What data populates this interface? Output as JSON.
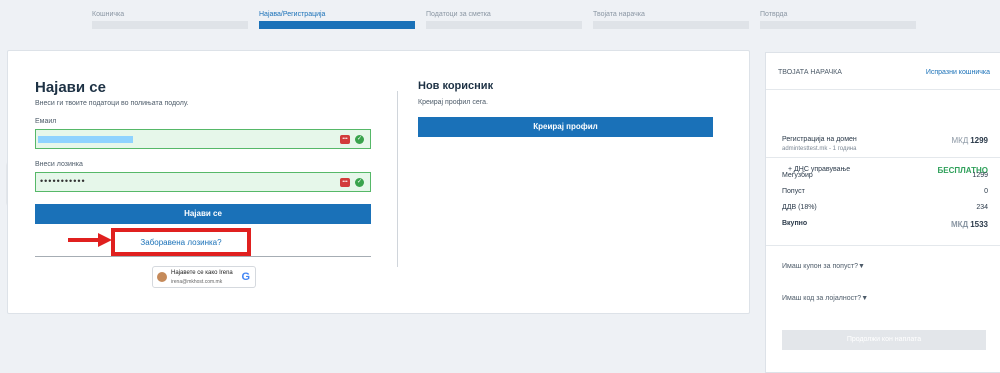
{
  "steps": [
    {
      "label": "Кошничка"
    },
    {
      "label": "Најава/Регистрација"
    },
    {
      "label": "Податоци за сметка"
    },
    {
      "label": "Твојата нарачка"
    },
    {
      "label": "Потврда"
    }
  ],
  "active_step": 1,
  "login": {
    "title": "Најави се",
    "subtitle": "Внеси ги твоите податоци во полињата подолу.",
    "email_label": "Емаил",
    "email_value": "",
    "password_label": "Внеси лозинка",
    "password_value": "•••••••••••",
    "submit_label": "Најави се",
    "forgot_label": "Заборавена лозинка?"
  },
  "google": {
    "name_line": "Најавете се како Irena",
    "email": "irena@mkhost.com.mk",
    "icon": "G"
  },
  "new_user": {
    "title": "Нов корисник",
    "subtitle": "Креирај профил сега.",
    "button_label": "Креирај профил"
  },
  "cart": {
    "title": "ТВОЈАТА НАРАЧКА",
    "empty_label": "Испразни кошничка",
    "item_name": "Регистрација на домен",
    "item_detail": "admintesttest.mk - 1 година",
    "item_currency": "МКД",
    "item_price": "1299",
    "addon_label": "+ ДНС управување",
    "addon_price": "БЕСПЛАТНО",
    "subtotal_label": "Меѓузбир",
    "subtotal_value": "1299",
    "discount_label": "Попуст",
    "discount_value": "0",
    "vat_label": "ДДВ (18%)",
    "vat_value": "234",
    "total_label": "Вкупно",
    "total_currency": "МКД",
    "total_value": "1533",
    "coupon_label": "Имаш купон за попуст?▼",
    "loyalty_label": "Имаш код за лојалност?▼",
    "pay_label": "Продолжи кон наплата"
  },
  "colors": {
    "primary": "#1a71b8",
    "valid_field": "#e6f7ea",
    "highlight": "#e0201f",
    "free": "#2fa05a"
  }
}
